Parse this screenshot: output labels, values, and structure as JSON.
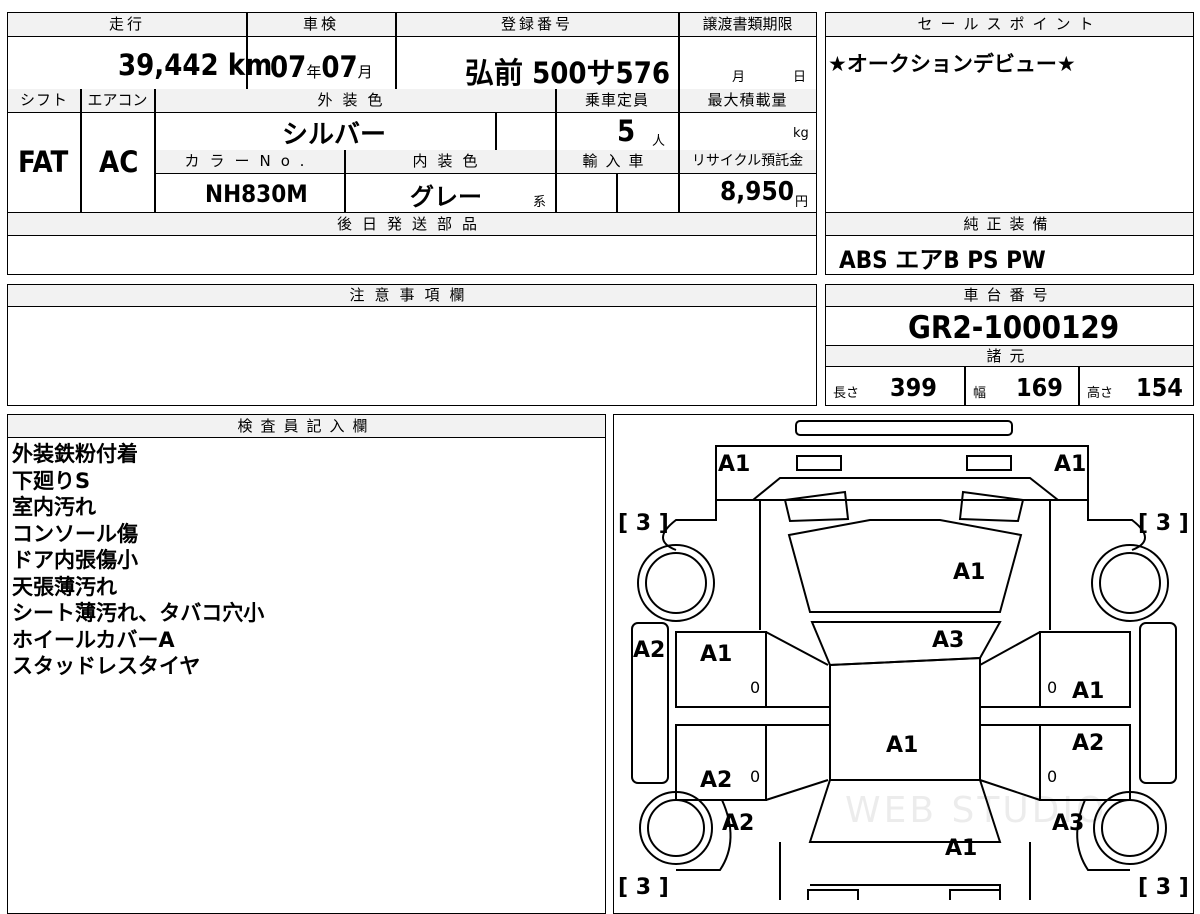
{
  "header": {
    "mileage_label": "走行",
    "inspection_label": "車検",
    "registration_label": "登録番号",
    "transfer_label": "譲渡書類期限",
    "sales_point_label": "セールスポイント",
    "shift_label": "シフト",
    "aircon_label": "エアコン",
    "exterior_color_label": "外装色",
    "capacity_label": "乗車定員",
    "max_load_label": "最大積載量",
    "color_no_label": "カラーNo.",
    "interior_color_label": "内装色",
    "import_label": "輸入車",
    "recycle_label": "リサイクル預託金"
  },
  "vehicle": {
    "mileage": "39,442",
    "mileage_unit": "km",
    "inspection_year": "07",
    "year_unit": "年",
    "inspection_month": "07",
    "month_unit": "月",
    "registration": "弘前 500サ576",
    "transfer_month_unit": "月",
    "transfer_day_unit": "日",
    "shift": "FAT",
    "aircon": "AC",
    "exterior_color": "シルバー",
    "capacity": "5",
    "capacity_unit": "人",
    "load_unit": "kg",
    "color_no": "NH830M",
    "interior_color": "グレー",
    "interior_suffix": "系",
    "recycle_fee": "8,950",
    "recycle_unit": "円",
    "sales_point": "★オークションデビュー★"
  },
  "parts": {
    "later_parts_label": "後日発送部品"
  },
  "equipment": {
    "label": "純正装備",
    "value": "ABS エアB PS PW"
  },
  "caution": {
    "label": "注意事項欄"
  },
  "chassis": {
    "label": "車台番号",
    "number": "GR2-1000129",
    "specs_label": "諸元",
    "length_label": "長さ",
    "length": "399",
    "width_label": "幅",
    "width": "169",
    "height_label": "高さ",
    "height": "154"
  },
  "inspector": {
    "label": "検査員記入欄",
    "notes": [
      "外装鉄粉付着",
      "下廻りS",
      "室内汚れ",
      "コンソール傷",
      "ドア内張傷小",
      "天張薄汚れ",
      "シート薄汚れ、タバコ穴小",
      "ホイールカバーA",
      "スタッドレスタイヤ"
    ]
  },
  "diagram": {
    "marks": {
      "front_left": "A1",
      "front_right": "A1",
      "hood": "A1",
      "windshield": "A3",
      "left_front_fender": "A2",
      "left_front_door": "A1",
      "right_front_door": "A1",
      "roof": "A1",
      "right_rear_door": "A2",
      "left_rear_door": "A2",
      "left_rear_fender": "A2",
      "right_rear_fender": "A3",
      "rear": "A1"
    },
    "tread": "3",
    "zero": "0",
    "watermark": "WEB STUDIO"
  }
}
